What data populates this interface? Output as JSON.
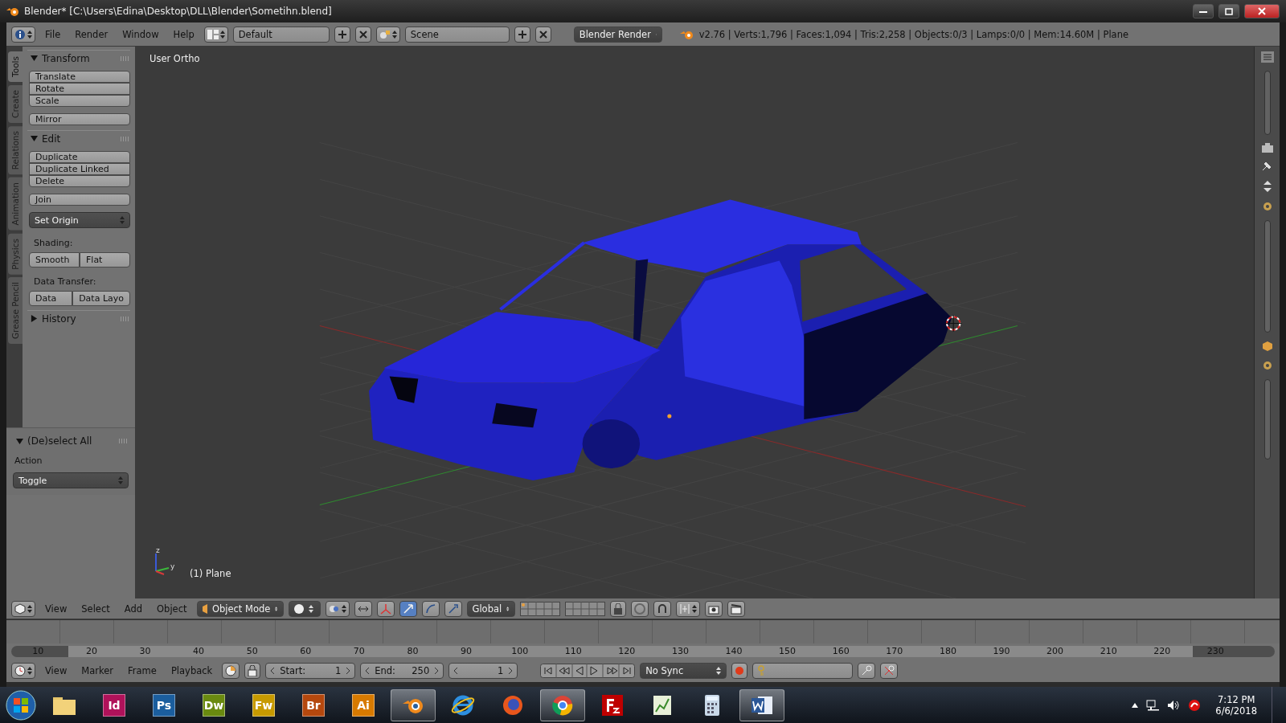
{
  "window": {
    "title": "Blender* [C:\\Users\\Edina\\Desktop\\DLL\\Blender\\Sometihn.blend]"
  },
  "info_header": {
    "menus": [
      "File",
      "Render",
      "Window",
      "Help"
    ],
    "layout": "Default",
    "scene": "Scene",
    "engine": "Blender Render",
    "stats": "v2.76 | Verts:1,796 | Faces:1,094 | Tris:2,258 | Objects:0/3 | Lamps:0/0 | Mem:14.60M | Plane"
  },
  "tool_tabs": [
    {
      "label": "Tools",
      "selected": true
    },
    {
      "label": "Create",
      "selected": false
    },
    {
      "label": "Relations",
      "selected": false
    },
    {
      "label": "Animation",
      "selected": false
    },
    {
      "label": "Physics",
      "selected": false
    },
    {
      "label": "Grease Pencil",
      "selected": false
    }
  ],
  "tool_panel": {
    "sections": [
      {
        "title": "Transform",
        "expanded": true,
        "items": [
          {
            "kind": "stack",
            "buttons": [
              "Translate",
              "Rotate",
              "Scale"
            ]
          },
          {
            "kind": "stack",
            "buttons": [
              "Mirror"
            ]
          }
        ]
      },
      {
        "title": "Edit",
        "expanded": true,
        "items": [
          {
            "kind": "stack",
            "buttons": [
              "Duplicate",
              "Duplicate Linked",
              "Delete"
            ]
          },
          {
            "kind": "stack",
            "buttons": [
              "Join"
            ]
          },
          {
            "kind": "dropdown",
            "value": "Set Origin"
          },
          {
            "kind": "label",
            "text": "Shading:"
          },
          {
            "kind": "pair",
            "buttons": [
              "Smooth",
              "Flat"
            ]
          },
          {
            "kind": "label",
            "text": "Data Transfer:"
          },
          {
            "kind": "pair",
            "buttons": [
              "Data",
              "Data Layo"
            ]
          }
        ]
      },
      {
        "title": "History",
        "expanded": false
      }
    ]
  },
  "operator_panel": {
    "title": "(De)select All",
    "expanded": true,
    "label": "Action",
    "value": "Toggle"
  },
  "viewport": {
    "view_name": "User Ortho",
    "object_label": "(1) Plane",
    "axis_labels": [
      "z",
      "y"
    ]
  },
  "view3d_header": {
    "menus": [
      "View",
      "Select",
      "Add",
      "Object"
    ],
    "mode": "Object Mode",
    "orientation": "Global"
  },
  "timeline": {
    "ticks": [
      "10",
      "20",
      "30",
      "40",
      "50",
      "60",
      "70",
      "80",
      "90",
      "100",
      "110",
      "120",
      "130",
      "140",
      "150",
      "160",
      "170",
      "180",
      "190",
      "200",
      "210",
      "220",
      "230"
    ],
    "menus": [
      "View",
      "Marker",
      "Frame",
      "Playback"
    ],
    "start_label": "Start:",
    "start": "1",
    "end_label": "End:",
    "end": "250",
    "current": "1",
    "sync": "No Sync"
  },
  "taskbar": {
    "apps": [
      {
        "kind": "folder",
        "running": false
      },
      {
        "kind": "letters",
        "label": "Id",
        "color": "#b0125a",
        "running": false
      },
      {
        "kind": "letters",
        "label": "Ps",
        "color": "#1b5e9e",
        "running": false
      },
      {
        "kind": "letters",
        "label": "Dw",
        "color": "#6a8a10",
        "running": false
      },
      {
        "kind": "letters",
        "label": "Fw",
        "color": "#c79a00",
        "running": false
      },
      {
        "kind": "letters",
        "label": "Br",
        "color": "#b5480e",
        "running": false
      },
      {
        "kind": "letters",
        "label": "Ai",
        "color": "#d77a00",
        "running": false
      },
      {
        "kind": "blender",
        "running": true
      },
      {
        "kind": "ie",
        "running": false
      },
      {
        "kind": "firefox",
        "running": false
      },
      {
        "kind": "chrome",
        "running": true
      },
      {
        "kind": "filezilla",
        "running": false
      },
      {
        "kind": "chart",
        "running": false
      },
      {
        "kind": "calculator",
        "running": false
      },
      {
        "kind": "word",
        "running": true
      }
    ],
    "time": "7:12 PM",
    "date": "6/6/2018"
  }
}
